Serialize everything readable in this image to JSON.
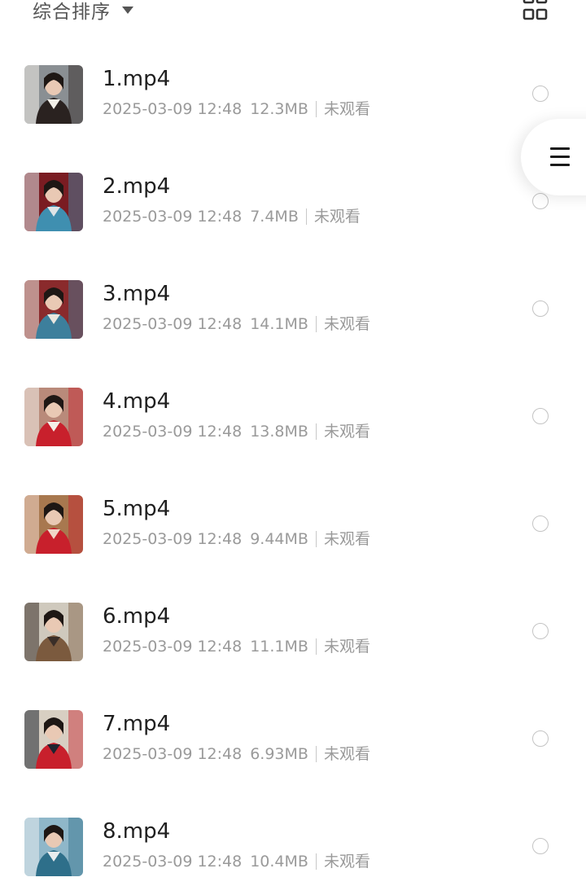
{
  "sort": {
    "label": "综合排序",
    "caret_icon": "caret-down-icon"
  },
  "view_toggle": {
    "icon": "grid-view-icon"
  },
  "float_menu": {
    "icon": "menu-lines-icon"
  },
  "colors": {
    "title": "#1f1f1f",
    "meta": "#9a9a9a",
    "radio_border": "#c4c4c4",
    "background": "#ffffff"
  },
  "files": [
    {
      "name": "1.mp4",
      "date": "2025-03-09 12:48",
      "size": "12.3MB",
      "status": "未观看",
      "thumb_colors": [
        "#8a8f93",
        "#f2efe8",
        "#2a2220"
      ]
    },
    {
      "name": "2.mp4",
      "date": "2025-03-09 12:48",
      "size": "7.4MB",
      "status": "未观看",
      "thumb_colors": [
        "#7a1c22",
        "#dfe4e6",
        "#3f8fb0"
      ]
    },
    {
      "name": "3.mp4",
      "date": "2025-03-09 12:48",
      "size": "14.1MB",
      "status": "未观看",
      "thumb_colors": [
        "#8a2a2c",
        "#e9e6df",
        "#3d7f9c"
      ]
    },
    {
      "name": "4.mp4",
      "date": "2025-03-09 12:48",
      "size": "13.8MB",
      "status": "未观看",
      "thumb_colors": [
        "#b98a7a",
        "#f4efe8",
        "#c8202c"
      ]
    },
    {
      "name": "5.mp4",
      "date": "2025-03-09 12:48",
      "size": "9.44MB",
      "status": "未观看",
      "thumb_colors": [
        "#a8784f",
        "#f0d6c8",
        "#c8202c"
      ]
    },
    {
      "name": "6.mp4",
      "date": "2025-03-09 12:48",
      "size": "11.1MB",
      "status": "未观看",
      "thumb_colors": [
        "#cfc9bd",
        "#3a2e28",
        "#7b5a3e"
      ]
    },
    {
      "name": "7.mp4",
      "date": "2025-03-09 12:48",
      "size": "6.93MB",
      "status": "未观看",
      "thumb_colors": [
        "#d8cfc2",
        "#1e2430",
        "#c8202c"
      ]
    },
    {
      "name": "8.mp4",
      "date": "2025-03-09 12:48",
      "size": "10.4MB",
      "status": "未观看",
      "thumb_colors": [
        "#8fb7c9",
        "#e8ecee",
        "#2e6f8a"
      ]
    }
  ]
}
